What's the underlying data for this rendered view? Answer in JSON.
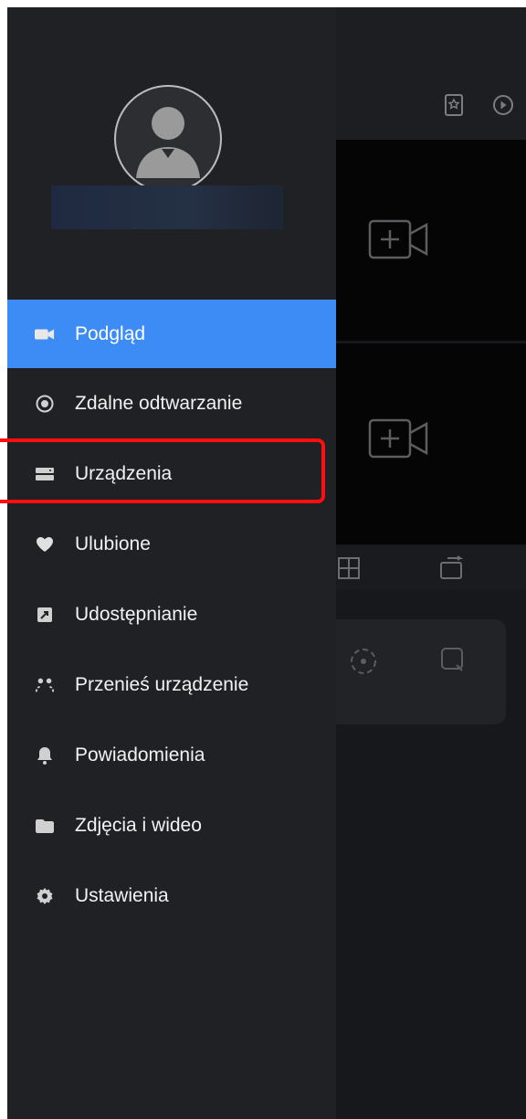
{
  "menu": {
    "items": [
      {
        "label": "Podgląd",
        "icon": "video-camera-icon",
        "active": true
      },
      {
        "label": "Zdalne odtwarzanie",
        "icon": "playback-icon"
      },
      {
        "label": "Urządzenia",
        "icon": "devices-icon"
      },
      {
        "label": "Ulubione",
        "icon": "heart-icon"
      },
      {
        "label": "Udostępnianie",
        "icon": "share-icon"
      },
      {
        "label": "Przenieś urządzenie",
        "icon": "transfer-device-icon"
      },
      {
        "label": "Powiadomienia",
        "icon": "bell-icon"
      },
      {
        "label": "Zdjęcia i wideo",
        "icon": "folder-icon"
      },
      {
        "label": "Ustawienia",
        "icon": "gear-icon"
      }
    ]
  },
  "colors": {
    "accent": "#3d8cf5",
    "highlight": "#ff0f0f",
    "drawer_bg": "#202124"
  }
}
